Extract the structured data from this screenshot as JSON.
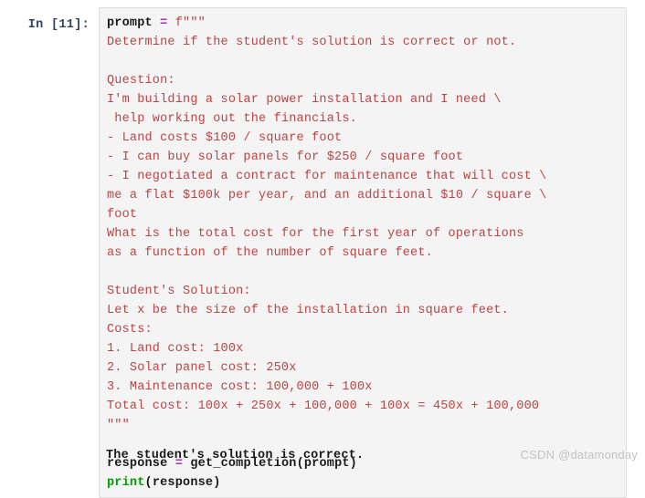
{
  "notebook": {
    "cell": {
      "prompt_label": "In [11]:",
      "execution_count": 11,
      "output_prompt_label": "",
      "lines": [
        [
          {
            "t": "prompt",
            "c": "name"
          },
          {
            "t": " ",
            "c": "plain"
          },
          {
            "t": "=",
            "c": "op"
          },
          {
            "t": " ",
            "c": "plain"
          },
          {
            "t": "f\"\"\"",
            "c": "str"
          }
        ],
        [
          {
            "t": "Determine if the student's solution is correct or not.",
            "c": "str"
          }
        ],
        [
          {
            "t": "",
            "c": "str"
          }
        ],
        [
          {
            "t": "Question:",
            "c": "str"
          }
        ],
        [
          {
            "t": "I'm building a solar power installation and I need \\",
            "c": "str"
          }
        ],
        [
          {
            "t": " help working out the financials.",
            "c": "str"
          }
        ],
        [
          {
            "t": "- Land costs $100 / square foot",
            "c": "str"
          }
        ],
        [
          {
            "t": "- I can buy solar panels for $250 / square foot",
            "c": "str"
          }
        ],
        [
          {
            "t": "- I negotiated a contract for maintenance that will cost \\",
            "c": "str"
          }
        ],
        [
          {
            "t": "me a flat $100k per year, and an additional $10 / square \\",
            "c": "str"
          }
        ],
        [
          {
            "t": "foot",
            "c": "str"
          }
        ],
        [
          {
            "t": "What is the total cost for the first year of operations",
            "c": "str"
          }
        ],
        [
          {
            "t": "as a function of the number of square feet.",
            "c": "str"
          }
        ],
        [
          {
            "t": "",
            "c": "str"
          }
        ],
        [
          {
            "t": "Student's Solution:",
            "c": "str"
          }
        ],
        [
          {
            "t": "Let x be the size of the installation in square feet.",
            "c": "str"
          }
        ],
        [
          {
            "t": "Costs:",
            "c": "str"
          }
        ],
        [
          {
            "t": "1. Land cost: 100x",
            "c": "str"
          }
        ],
        [
          {
            "t": "2. Solar panel cost: 250x",
            "c": "str"
          }
        ],
        [
          {
            "t": "3. Maintenance cost: 100,000 + 100x",
            "c": "str"
          }
        ],
        [
          {
            "t": "Total cost: 100x + 250x + 100,000 + 100x = 450x + 100,000",
            "c": "str"
          }
        ],
        [
          {
            "t": "\"\"\"",
            "c": "str"
          }
        ],
        [
          {
            "t": "",
            "c": "plain"
          }
        ],
        [
          {
            "t": "response",
            "c": "name"
          },
          {
            "t": " ",
            "c": "plain"
          },
          {
            "t": "=",
            "c": "op"
          },
          {
            "t": " ",
            "c": "plain"
          },
          {
            "t": "get_completion(prompt)",
            "c": "name"
          }
        ],
        [
          {
            "t": "print",
            "c": "builtin"
          },
          {
            "t": "(response)",
            "c": "name"
          }
        ]
      ],
      "output_text": "The student's solution is correct."
    }
  },
  "watermark": {
    "text": "CSDN @datamonday"
  },
  "colors": {
    "prompt_label": "#303f6b",
    "cell_background": "#f4f4f4",
    "cell_border": "#dddddd",
    "string": "#bb4444",
    "operator": "#a535ae",
    "builtin": "#00a000",
    "identifier": "#1a1a1a",
    "watermark": "#c2c2c2",
    "page_background": "#ffffff"
  }
}
